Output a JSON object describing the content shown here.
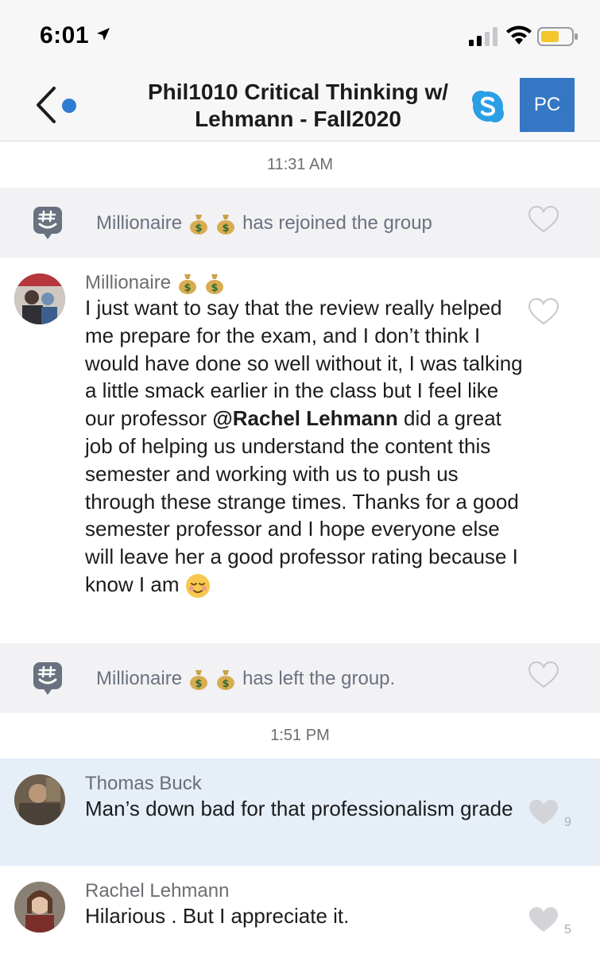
{
  "status_bar": {
    "time": "6:01"
  },
  "nav": {
    "title": "Phil1010 Critical Thinking w/ Lehmann - Fall2020",
    "avatar_initials": "PC"
  },
  "messages": {
    "ts1": "11:31 AM",
    "sys1": {
      "name": "Millionaire",
      "name_emoji": "money-bag x2",
      "text": "has rejoined the group"
    },
    "msg1": {
      "sender": "Millionaire",
      "sender_emoji": "money-bag x2",
      "text_part1": "I just want to say that the review really helped me prepare for the exam, and I don’t think I would have done so well without it, I was talking a little smack earlier in the class but I feel like our professor ",
      "mention": "@Rachel Lehmann",
      "text_part2": " did a great job of helping us understand the content this semester and working with us to push us through these strange times. Thanks for a good semester professor and I hope everyone else will leave her a good professor rating because I know I am",
      "trailing_emoji": "relieved-face"
    },
    "sys2": {
      "name": "Millionaire",
      "name_emoji": "money-bag x2",
      "text": "has left the group."
    },
    "ts2": "1:51 PM",
    "msg2": {
      "sender": "Thomas Buck",
      "text": "Man’s down bad for that professionalism grade",
      "likes": "9"
    },
    "msg3": {
      "sender": "Rachel Lehmann",
      "text": "Hilarious . But I appreciate it.",
      "likes": "5"
    }
  },
  "colors": {
    "accent": "#3577c4",
    "dot": "#2f7bd3",
    "highlight": "#e6eff8",
    "system_bg": "#f2f2f4"
  }
}
